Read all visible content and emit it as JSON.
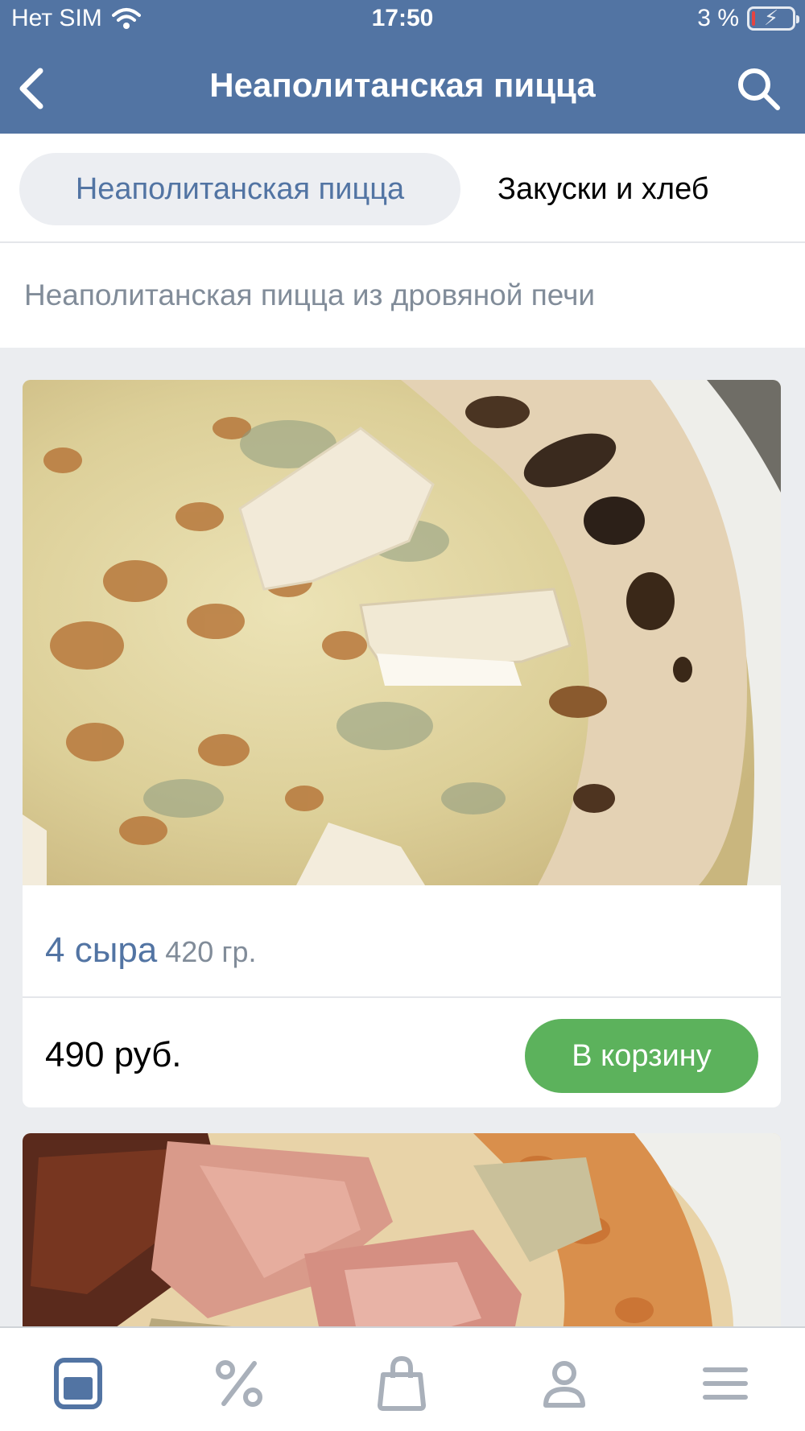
{
  "status_bar": {
    "carrier": "Нет SIM",
    "time": "17:50",
    "battery": "3 %"
  },
  "nav": {
    "title": "Неаполитанская пицца",
    "back_icon": "chevron-left-icon",
    "search_icon": "search-icon"
  },
  "tabs": [
    {
      "label": "Неаполитанская пицца",
      "active": true
    },
    {
      "label": "Закуски и хлеб",
      "active": false
    }
  ],
  "section_description": "Неаполитанская пицца из дровяной печи",
  "products": [
    {
      "name": "4 сыра",
      "weight": "420 гр.",
      "price": "490 руб.",
      "cart_label": "В корзину",
      "image": "four-cheese-pizza-photo"
    },
    {
      "image": "prosciutto-pizza-photo"
    }
  ],
  "tabbar": [
    {
      "icon": "menu-catalog-icon",
      "active": true
    },
    {
      "icon": "percent-icon",
      "active": false
    },
    {
      "icon": "shopping-bag-icon",
      "active": false
    },
    {
      "icon": "profile-icon",
      "active": false
    },
    {
      "icon": "hamburger-menu-icon",
      "active": false
    }
  ],
  "colors": {
    "header": "#5274a3",
    "accent": "#5274a3",
    "cart_button": "#5cb25c",
    "muted_text": "#818c99",
    "inactive_icon": "#a9b0ba"
  }
}
